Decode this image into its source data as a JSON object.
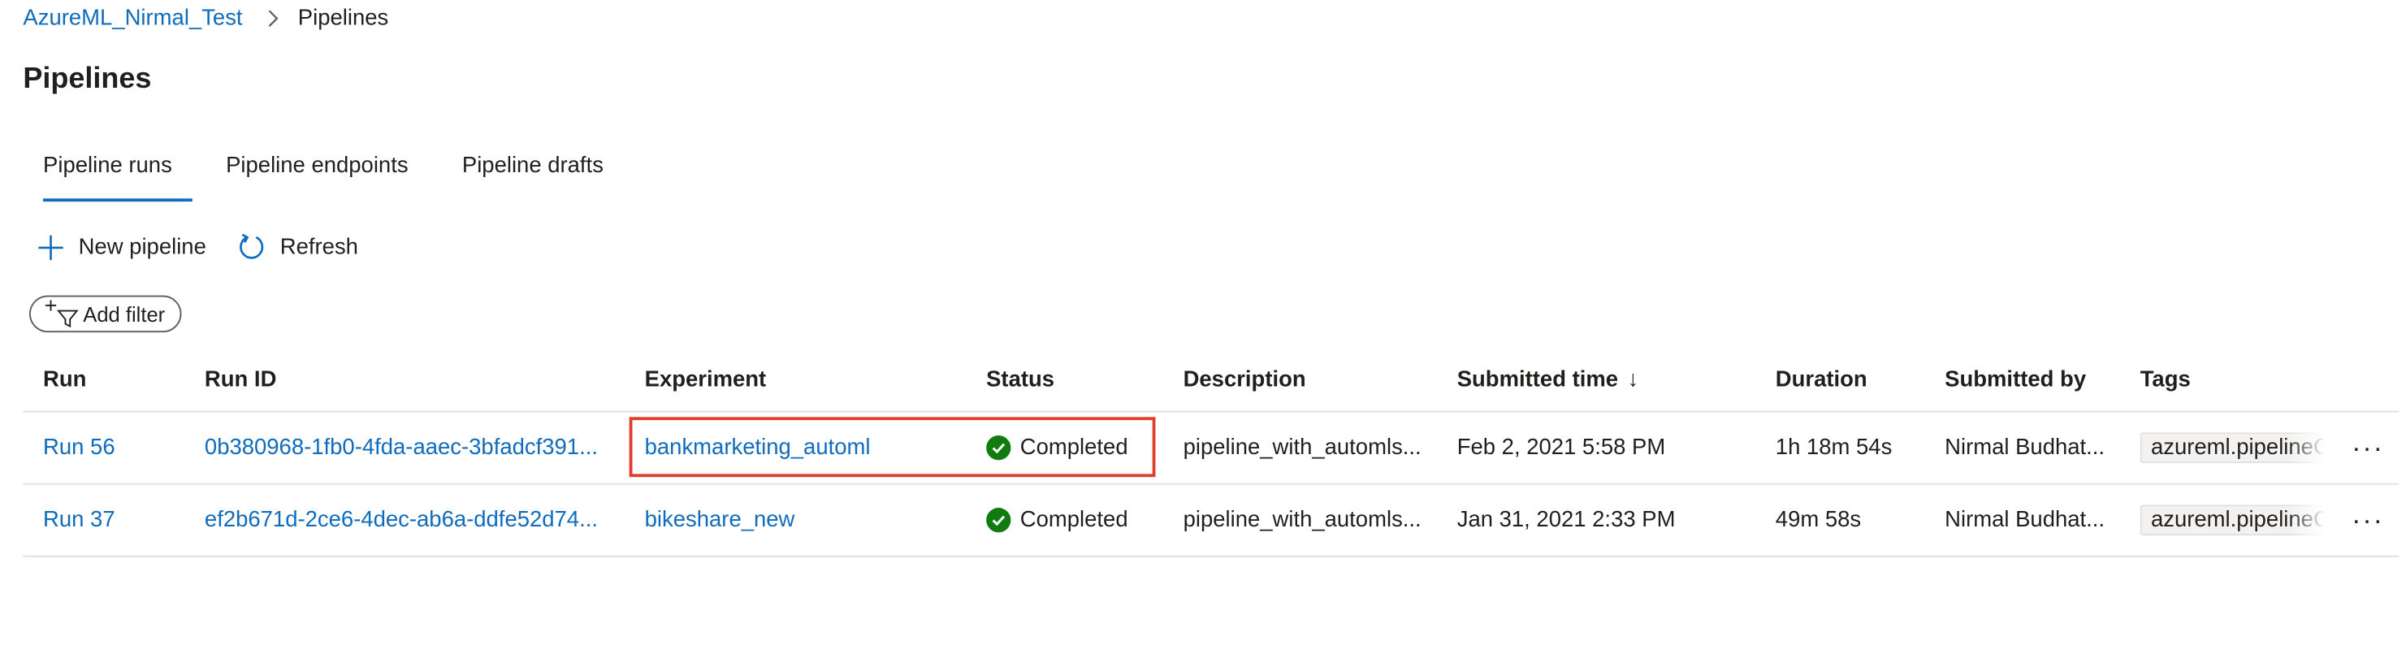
{
  "breadcrumb": {
    "workspace": "AzureML_Nirmal_Test",
    "current": "Pipelines"
  },
  "page": {
    "title": "Pipelines"
  },
  "tabs": [
    {
      "label": "Pipeline runs",
      "active": true
    },
    {
      "label": "Pipeline endpoints",
      "active": false
    },
    {
      "label": "Pipeline drafts",
      "active": false
    }
  ],
  "toolbar": {
    "new_pipeline": "New pipeline",
    "refresh": "Refresh"
  },
  "filter": {
    "add_filter": "Add filter"
  },
  "table": {
    "columns": {
      "run": "Run",
      "run_id": "Run ID",
      "experiment": "Experiment",
      "status": "Status",
      "description": "Description",
      "submitted_time": "Submitted time",
      "duration": "Duration",
      "submitted_by": "Submitted by",
      "tags": "Tags"
    },
    "sort_indicator": "↓",
    "rows": [
      {
        "run": "Run 56",
        "run_id": "0b380968-1fb0-4fda-aaec-3bfadcf391...",
        "experiment": "bankmarketing_automl",
        "status": "Completed",
        "description": "pipeline_with_automls...",
        "submitted_time": "Feb 2, 2021 5:58 PM",
        "duration": "1h 18m 54s",
        "submitted_by": "Nirmal Budhat...",
        "tag": "azureml.pipelineC",
        "more": "···"
      },
      {
        "run": "Run 37",
        "run_id": "ef2b671d-2ce6-4dec-ab6a-ddfe52d74...",
        "experiment": "bikeshare_new",
        "status": "Completed",
        "description": "pipeline_with_automls...",
        "submitted_time": "Jan 31, 2021 2:33 PM",
        "duration": "49m 58s",
        "submitted_by": "Nirmal Budhat...",
        "tag": "azureml.pipelineC",
        "more": "···"
      }
    ]
  },
  "colors": {
    "link": "#0f6cbd",
    "success": "#107c10",
    "highlight": "#e03e2d",
    "border": "#e1dfdd"
  },
  "icons": {
    "breadcrumb_separator": "chevron-right-icon",
    "new_pipeline": "plus-icon",
    "refresh": "refresh-icon",
    "filter": "add-filter-icon",
    "status": "check-circle-icon",
    "more": "more-icon"
  }
}
